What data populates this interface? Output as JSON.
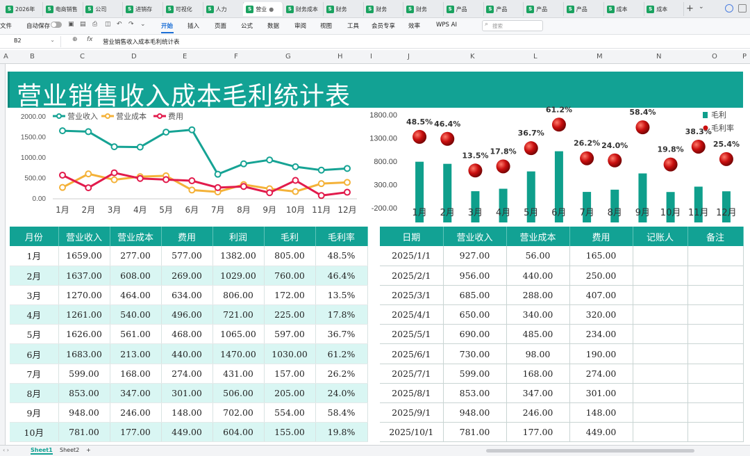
{
  "tabs": [
    {
      "label": "2026年"
    },
    {
      "label": "电商销售"
    },
    {
      "label": "公司"
    },
    {
      "label": "进销存"
    },
    {
      "label": "可视化"
    },
    {
      "label": "人力"
    },
    {
      "label": "营业",
      "active": true
    },
    {
      "label": "财务成本"
    },
    {
      "label": "财务"
    },
    {
      "label": "财务"
    },
    {
      "label": "财务"
    },
    {
      "label": "产品"
    },
    {
      "label": "产品"
    },
    {
      "label": "产品"
    },
    {
      "label": "产品"
    },
    {
      "label": "成本"
    },
    {
      "label": "成本"
    }
  ],
  "ribbon": {
    "file": "文件",
    "autosave": "自动保存",
    "items": [
      "开始",
      "插入",
      "页面",
      "公式",
      "数据",
      "审阅",
      "视图",
      "工具",
      "会员专享",
      "效率",
      "WPS AI"
    ],
    "search_placeholder": "搜索"
  },
  "formula_bar": {
    "cell_ref": "B2",
    "fx": "fx",
    "formula": "营业销售收入成本毛利统计表"
  },
  "columns": [
    "A",
    "B",
    "C",
    "D",
    "E",
    "F",
    "G",
    "H",
    "I",
    "J",
    "K",
    "L",
    "M",
    "N",
    "O",
    "P"
  ],
  "title": "营业销售收入成本毛利统计表",
  "chart_data": [
    {
      "type": "line",
      "categories": [
        "1月",
        "2月",
        "3月",
        "4月",
        "5月",
        "6月",
        "7月",
        "8月",
        "9月",
        "10月",
        "11月",
        "12月"
      ],
      "series": [
        {
          "name": "营业收入",
          "color": "#16a394",
          "values": [
            1659,
            1637,
            1270,
            1261,
            1626,
            1683,
            599,
            853,
            948,
            781,
            700,
            740
          ]
        },
        {
          "name": "营业成本",
          "color": "#f4b239",
          "values": [
            277,
            608,
            464,
            540,
            561,
            213,
            168,
            347,
            246,
            177,
            370,
            400
          ]
        },
        {
          "name": "费用",
          "color": "#e21b4c",
          "values": [
            577,
            269,
            634,
            496,
            468,
            440,
            274,
            301,
            148,
            449,
            80,
            160
          ]
        }
      ],
      "yticks": [
        "2000.00",
        "1500.00",
        "1000.00",
        "500.00",
        "0.00"
      ],
      "ylim": [
        0,
        2000
      ],
      "legend": "top-left"
    },
    {
      "type": "bar",
      "categories": [
        "1月",
        "2月",
        "3月",
        "4月",
        "5月",
        "6月",
        "7月",
        "8月",
        "9月",
        "10月",
        "11月",
        "12月"
      ],
      "series": [
        {
          "name": "毛利",
          "color": "#0f9f8c",
          "values": [
            805,
            760,
            172,
            225,
            597,
            1030,
            157,
            205,
            554,
            155,
            270,
            170
          ]
        },
        {
          "name": "毛利率",
          "color": "#c90f0f",
          "values": [
            48.5,
            46.4,
            13.5,
            17.8,
            36.7,
            61.2,
            26.2,
            24.0,
            58.4,
            19.8,
            38.3,
            25.4
          ]
        }
      ],
      "rate_labels": [
        "48.5%",
        "46.4%",
        "13.5%",
        "17.8%",
        "36.7%",
        "61.2%",
        "26.2%",
        "24.0%",
        "58.4%",
        "19.8%",
        "38.3%",
        "25.4%"
      ],
      "yticks": [
        "1800.00",
        "1300.00",
        "800.00",
        "300.00",
        "-200.00"
      ],
      "ylim": [
        -200,
        1800
      ],
      "legend": "top-right"
    }
  ],
  "left_table": {
    "headers": [
      "月份",
      "营业收入",
      "营业成本",
      "费用",
      "利润",
      "毛利",
      "毛利率"
    ],
    "rows": [
      [
        "1月",
        "1659.00",
        "277.00",
        "577.00",
        "1382.00",
        "805.00",
        "48.5%"
      ],
      [
        "2月",
        "1637.00",
        "608.00",
        "269.00",
        "1029.00",
        "760.00",
        "46.4%"
      ],
      [
        "3月",
        "1270.00",
        "464.00",
        "634.00",
        "806.00",
        "172.00",
        "13.5%"
      ],
      [
        "4月",
        "1261.00",
        "540.00",
        "496.00",
        "721.00",
        "225.00",
        "17.8%"
      ],
      [
        "5月",
        "1626.00",
        "561.00",
        "468.00",
        "1065.00",
        "597.00",
        "36.7%"
      ],
      [
        "6月",
        "1683.00",
        "213.00",
        "440.00",
        "1470.00",
        "1030.00",
        "61.2%"
      ],
      [
        "7月",
        "599.00",
        "168.00",
        "274.00",
        "431.00",
        "157.00",
        "26.2%"
      ],
      [
        "8月",
        "853.00",
        "347.00",
        "301.00",
        "506.00",
        "205.00",
        "24.0%"
      ],
      [
        "9月",
        "948.00",
        "246.00",
        "148.00",
        "702.00",
        "554.00",
        "58.4%"
      ],
      [
        "10月",
        "781.00",
        "177.00",
        "449.00",
        "604.00",
        "155.00",
        "19.8%"
      ]
    ]
  },
  "right_table": {
    "headers": [
      "日期",
      "营业收入",
      "营业成本",
      "费用",
      "记账人",
      "备注"
    ],
    "rows": [
      [
        "2025/1/1",
        "927.00",
        "56.00",
        "165.00",
        "",
        ""
      ],
      [
        "2025/2/1",
        "956.00",
        "440.00",
        "250.00",
        "",
        ""
      ],
      [
        "2025/3/1",
        "685.00",
        "288.00",
        "407.00",
        "",
        ""
      ],
      [
        "2025/4/1",
        "650.00",
        "340.00",
        "320.00",
        "",
        ""
      ],
      [
        "2025/5/1",
        "690.00",
        "485.00",
        "234.00",
        "",
        ""
      ],
      [
        "2025/6/1",
        "730.00",
        "98.00",
        "190.00",
        "",
        ""
      ],
      [
        "2025/7/1",
        "599.00",
        "168.00",
        "274.00",
        "",
        ""
      ],
      [
        "2025/8/1",
        "853.00",
        "347.00",
        "301.00",
        "",
        ""
      ],
      [
        "2025/9/1",
        "948.00",
        "246.00",
        "148.00",
        "",
        ""
      ],
      [
        "2025/10/1",
        "781.00",
        "177.00",
        "449.00",
        "",
        ""
      ]
    ]
  },
  "sheets": [
    {
      "label": "Sheet1",
      "active": true
    },
    {
      "label": "Sheet2"
    }
  ],
  "add_sheet": "+"
}
